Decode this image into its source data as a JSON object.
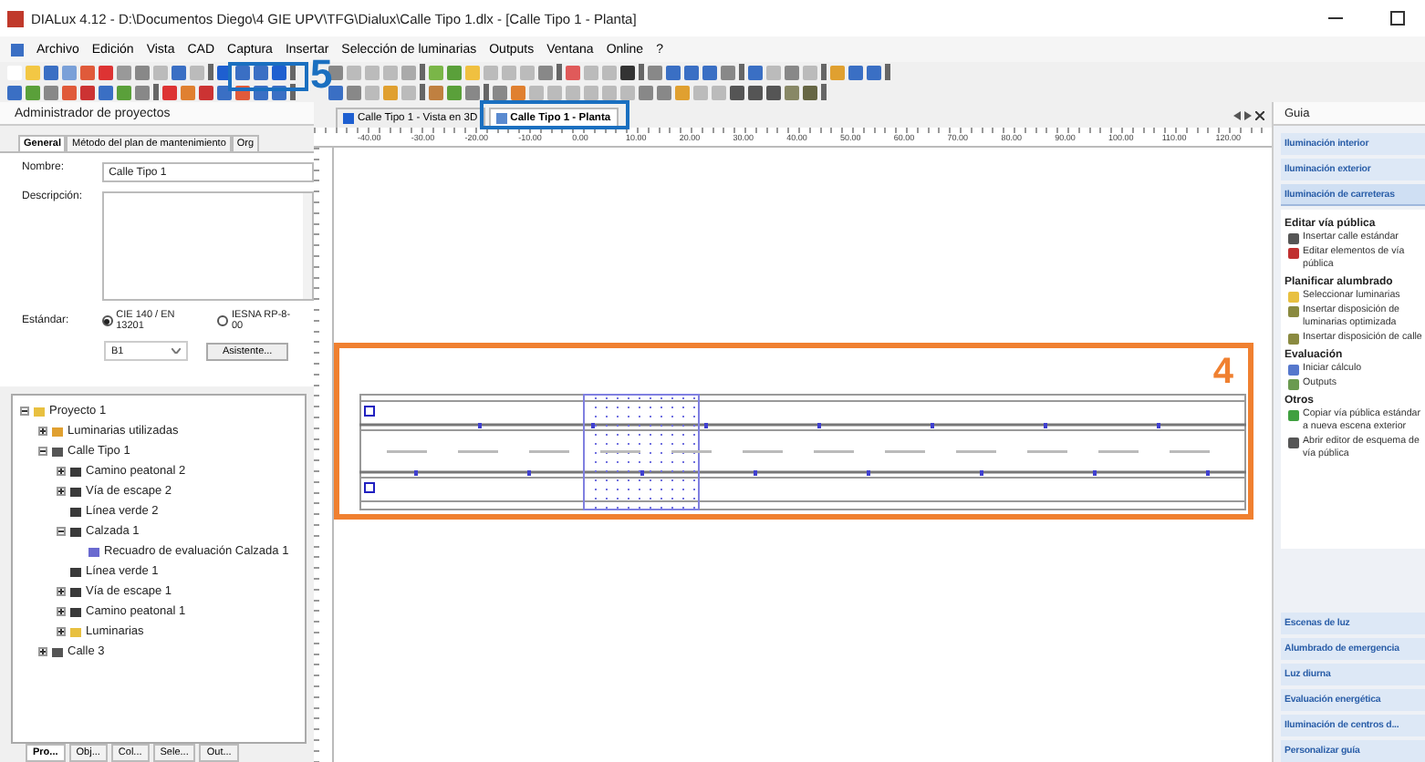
{
  "window": {
    "title": "DIALux 4.12 - D:\\Documentos Diego\\4 GIE UPV\\TFG\\Dialux\\Calle Tipo 1.dlx - [Calle Tipo 1 - Planta]"
  },
  "menu": [
    "Archivo",
    "Edición",
    "Vista",
    "CAD",
    "Captura",
    "Insertar",
    "Selección de luminarias",
    "Outputs",
    "Ventana",
    "Online",
    "?"
  ],
  "annotations": {
    "toolbar_label": "5",
    "canvas_label": "4"
  },
  "project_manager": {
    "title": "Administrador de proyectos",
    "tabs": [
      {
        "label": "General",
        "selected": true
      },
      {
        "label": "Método del plan de mantenimiento",
        "selected": false
      },
      {
        "label": "Org",
        "selected": false
      }
    ],
    "name_label": "Nombre:",
    "name_value": "Calle Tipo 1",
    "description_label": "Descripción:",
    "standard_label": "Estándar:",
    "standards": [
      {
        "label": "CIE 140 / EN 13201",
        "selected": true
      },
      {
        "label": "IESNA RP-8-00",
        "selected": false
      }
    ],
    "class_value": "B1",
    "wizard_button": "Asistente...",
    "tree": [
      {
        "label": "Proyecto 1",
        "kind": "folder",
        "expanded": true,
        "children": [
          {
            "label": "Luminarias utilizadas",
            "kind": "luminaires",
            "expanded": false
          },
          {
            "label": "Calle Tipo 1",
            "kind": "street",
            "expanded": true,
            "children": [
              {
                "label": "Camino peatonal 2",
                "kind": "element",
                "expanded": false
              },
              {
                "label": "Vía de escape 2",
                "kind": "element",
                "expanded": false
              },
              {
                "label": "Línea verde 2",
                "kind": "element"
              },
              {
                "label": "Calzada 1",
                "kind": "element",
                "expanded": true,
                "children": [
                  {
                    "label": "Recuadro de evaluación Calzada 1",
                    "kind": "evaluation"
                  }
                ]
              },
              {
                "label": "Línea verde 1",
                "kind": "element"
              },
              {
                "label": "Vía de escape 1",
                "kind": "element",
                "expanded": false
              },
              {
                "label": "Camino peatonal 1",
                "kind": "element",
                "expanded": false
              },
              {
                "label": "Luminarias",
                "kind": "folder",
                "expanded": false
              }
            ]
          },
          {
            "label": "Calle 3",
            "kind": "street",
            "expanded": false
          }
        ]
      }
    ],
    "bottom_tabs": [
      {
        "label": "Pro...",
        "selected": true
      },
      {
        "label": "Obj...",
        "selected": false
      },
      {
        "label": "Col...",
        "selected": false
      },
      {
        "label": "Sele...",
        "selected": false
      },
      {
        "label": "Out...",
        "selected": false
      }
    ]
  },
  "view": {
    "tabs": [
      {
        "label": "Calle Tipo 1 - Vista en 3D",
        "kind": "perspective",
        "selected": false
      },
      {
        "label": "Calle Tipo 1 - Planta",
        "kind": "plan",
        "selected": true
      }
    ],
    "ruler_labels": [
      "-40.00",
      "-30.00",
      "-20.00",
      "-10.00",
      "0.00",
      "10.00",
      "20.00",
      "30.00",
      "40.00",
      "50.00",
      "60.00",
      "70.00",
      "80.00",
      "90.00",
      "100.00",
      "110.00",
      "120.00"
    ]
  },
  "guide": {
    "title": "Guia",
    "sections": [
      {
        "title": "Iluminación interior",
        "expanded": false
      },
      {
        "title": "Iluminación exterior",
        "expanded": false
      },
      {
        "title": "Iluminación de carreteras",
        "expanded": true,
        "groups": [
          {
            "title": "Editar vía pública",
            "items": [
              {
                "label": "Insertar calle estándar",
                "kind": "street"
              },
              {
                "label": "Editar elementos de vía pública",
                "kind": "car"
              }
            ]
          },
          {
            "title": "Planificar alumbrado",
            "items": [
              {
                "label": "Seleccionar luminarias",
                "kind": "lamp"
              },
              {
                "label": "Insertar disposición de luminarias optimizada",
                "kind": "arrangement"
              },
              {
                "label": "Insertar disposición de calle",
                "kind": "arrangement"
              }
            ]
          },
          {
            "title": "Evaluación",
            "items": [
              {
                "label": "Iniciar cálculo",
                "kind": "calculator"
              },
              {
                "label": "Outputs",
                "kind": "document"
              }
            ]
          },
          {
            "title": "Otros",
            "items": [
              {
                "label": "Copiar vía pública estándar a nueva escena exterior",
                "kind": "copy"
              },
              {
                "label": "Abrir editor de esquema de vía pública",
                "kind": "street"
              }
            ]
          }
        ]
      },
      {
        "title": "Escenas de luz",
        "expanded": false
      },
      {
        "title": "Alumbrado de emergencia",
        "expanded": false
      },
      {
        "title": "Luz diurna",
        "expanded": false
      },
      {
        "title": "Evaluación energética",
        "expanded": false
      },
      {
        "title": "Iluminación de centros d...",
        "expanded": false
      },
      {
        "title": "Personalizar guía",
        "expanded": false
      }
    ]
  }
}
